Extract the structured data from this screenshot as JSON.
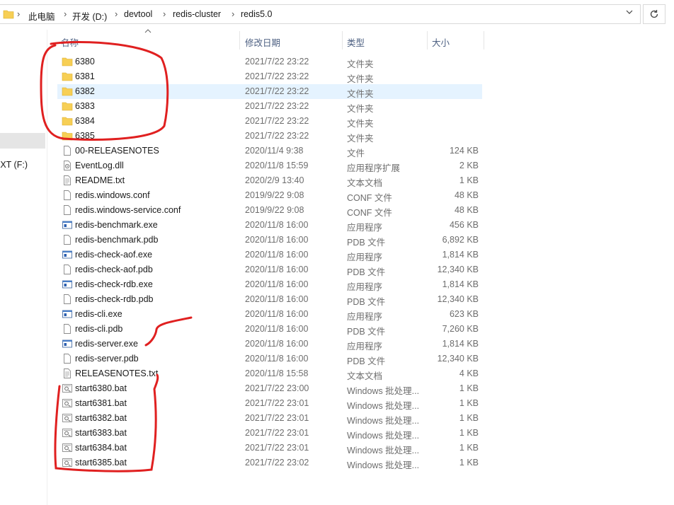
{
  "breadcrumb": [
    "此电脑",
    "开发 (D:)",
    "devtool",
    "redis-cluster",
    "redis5.0"
  ],
  "nav_pane": {
    "drive_label": "EXT (F:)"
  },
  "columns": {
    "name": "名称",
    "date": "修改日期",
    "type": "类型",
    "size": "大小"
  },
  "colors": {
    "annotation": "#e02020",
    "highlight_row": "#e5f3ff",
    "folder": "#f7cf55"
  },
  "files": [
    {
      "name": "6380",
      "date": "2021/7/22 23:22",
      "type": "文件夹",
      "size": "",
      "icon": "folder-icon"
    },
    {
      "name": "6381",
      "date": "2021/7/22 23:22",
      "type": "文件夹",
      "size": "",
      "icon": "folder-icon"
    },
    {
      "name": "6382",
      "date": "2021/7/22 23:22",
      "type": "文件夹",
      "size": "",
      "icon": "folder-icon",
      "highlighted": true
    },
    {
      "name": "6383",
      "date": "2021/7/22 23:22",
      "type": "文件夹",
      "size": "",
      "icon": "folder-icon"
    },
    {
      "name": "6384",
      "date": "2021/7/22 23:22",
      "type": "文件夹",
      "size": "",
      "icon": "folder-icon"
    },
    {
      "name": "6385",
      "date": "2021/7/22 23:22",
      "type": "文件夹",
      "size": "",
      "icon": "folder-icon"
    },
    {
      "name": "00-RELEASENOTES",
      "date": "2020/11/4 9:38",
      "type": "文件",
      "size": "124 KB",
      "icon": "file-icon"
    },
    {
      "name": "EventLog.dll",
      "date": "2020/11/8 15:59",
      "type": "应用程序扩展",
      "size": "2 KB",
      "icon": "dll-icon"
    },
    {
      "name": "README.txt",
      "date": "2020/2/9 13:40",
      "type": "文本文档",
      "size": "1 KB",
      "icon": "text-file-icon"
    },
    {
      "name": "redis.windows.conf",
      "date": "2019/9/22 9:08",
      "type": "CONF 文件",
      "size": "48 KB",
      "icon": "file-icon"
    },
    {
      "name": "redis.windows-service.conf",
      "date": "2019/9/22 9:08",
      "type": "CONF 文件",
      "size": "48 KB",
      "icon": "file-icon"
    },
    {
      "name": "redis-benchmark.exe",
      "date": "2020/11/8 16:00",
      "type": "应用程序",
      "size": "456 KB",
      "icon": "exe-icon"
    },
    {
      "name": "redis-benchmark.pdb",
      "date": "2020/11/8 16:00",
      "type": "PDB 文件",
      "size": "6,892 KB",
      "icon": "file-icon"
    },
    {
      "name": "redis-check-aof.exe",
      "date": "2020/11/8 16:00",
      "type": "应用程序",
      "size": "1,814 KB",
      "icon": "exe-icon"
    },
    {
      "name": "redis-check-aof.pdb",
      "date": "2020/11/8 16:00",
      "type": "PDB 文件",
      "size": "12,340 KB",
      "icon": "file-icon"
    },
    {
      "name": "redis-check-rdb.exe",
      "date": "2020/11/8 16:00",
      "type": "应用程序",
      "size": "1,814 KB",
      "icon": "exe-icon"
    },
    {
      "name": "redis-check-rdb.pdb",
      "date": "2020/11/8 16:00",
      "type": "PDB 文件",
      "size": "12,340 KB",
      "icon": "file-icon"
    },
    {
      "name": "redis-cli.exe",
      "date": "2020/11/8 16:00",
      "type": "应用程序",
      "size": "623 KB",
      "icon": "exe-icon"
    },
    {
      "name": "redis-cli.pdb",
      "date": "2020/11/8 16:00",
      "type": "PDB 文件",
      "size": "7,260 KB",
      "icon": "file-icon"
    },
    {
      "name": "redis-server.exe",
      "date": "2020/11/8 16:00",
      "type": "应用程序",
      "size": "1,814 KB",
      "icon": "exe-icon"
    },
    {
      "name": "redis-server.pdb",
      "date": "2020/11/8 16:00",
      "type": "PDB 文件",
      "size": "12,340 KB",
      "icon": "file-icon"
    },
    {
      "name": "RELEASENOTES.txt",
      "date": "2020/11/8 15:58",
      "type": "文本文档",
      "size": "4 KB",
      "icon": "text-file-icon"
    },
    {
      "name": "start6380.bat",
      "date": "2021/7/22 23:00",
      "type": "Windows 批处理...",
      "size": "1 KB",
      "icon": "batch-file-icon"
    },
    {
      "name": "start6381.bat",
      "date": "2021/7/22 23:01",
      "type": "Windows 批处理...",
      "size": "1 KB",
      "icon": "batch-file-icon"
    },
    {
      "name": "start6382.bat",
      "date": "2021/7/22 23:01",
      "type": "Windows 批处理...",
      "size": "1 KB",
      "icon": "batch-file-icon"
    },
    {
      "name": "start6383.bat",
      "date": "2021/7/22 23:01",
      "type": "Windows 批处理...",
      "size": "1 KB",
      "icon": "batch-file-icon"
    },
    {
      "name": "start6384.bat",
      "date": "2021/7/22 23:01",
      "type": "Windows 批处理...",
      "size": "1 KB",
      "icon": "batch-file-icon"
    },
    {
      "name": "start6385.bat",
      "date": "2021/7/22 23:02",
      "type": "Windows 批处理...",
      "size": "1 KB",
      "icon": "batch-file-icon"
    }
  ]
}
